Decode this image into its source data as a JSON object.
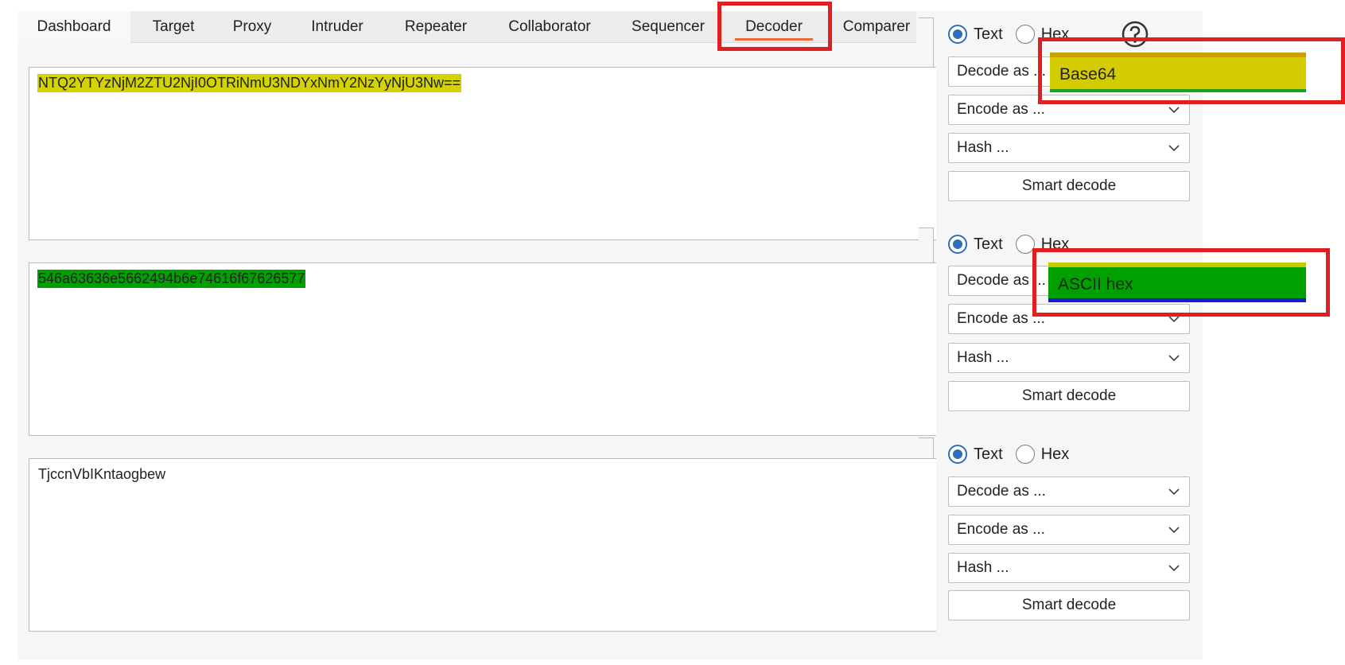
{
  "tabs": [
    {
      "label": "Dashboard"
    },
    {
      "label": "Target"
    },
    {
      "label": "Proxy"
    },
    {
      "label": "Intruder"
    },
    {
      "label": "Repeater"
    },
    {
      "label": "Collaborator"
    },
    {
      "label": "Sequencer"
    },
    {
      "label": "Decoder"
    },
    {
      "label": "Comparer"
    }
  ],
  "active_tab": "Decoder",
  "colors": {
    "accent_underline": "#ec6a3a",
    "highlight_yellow": "#d4d200",
    "highlight_green": "#00a000",
    "annotation_red": "#e02020",
    "radio_blue": "#2f6fba"
  },
  "panels": [
    {
      "content": "NTQ2YTYzNjM2ZTU2NjI0OTRiNmU3NDYxNmY2NzYyNjU3Nw==",
      "radio_text": "Text",
      "radio_hex": "Hex",
      "decode_label": "Decode as ...",
      "encode_label": "Encode as ...",
      "hash_label": "Hash ...",
      "smart_decode": "Smart decode",
      "popup_option": "Base64"
    },
    {
      "content": "546a63636e5662494b6e74616f67626577",
      "radio_text": "Text",
      "radio_hex": "Hex",
      "decode_label": "Decode as ...",
      "encode_label": "Encode as ...",
      "hash_label": "Hash ...",
      "smart_decode": "Smart decode",
      "popup_option": "ASCII hex"
    },
    {
      "content": "TjccnVbIKntaogbew",
      "radio_text": "Text",
      "radio_hex": "Hex",
      "decode_label": "Decode as ...",
      "encode_label": "Encode as ...",
      "hash_label": "Hash ...",
      "smart_decode": "Smart decode"
    }
  ]
}
